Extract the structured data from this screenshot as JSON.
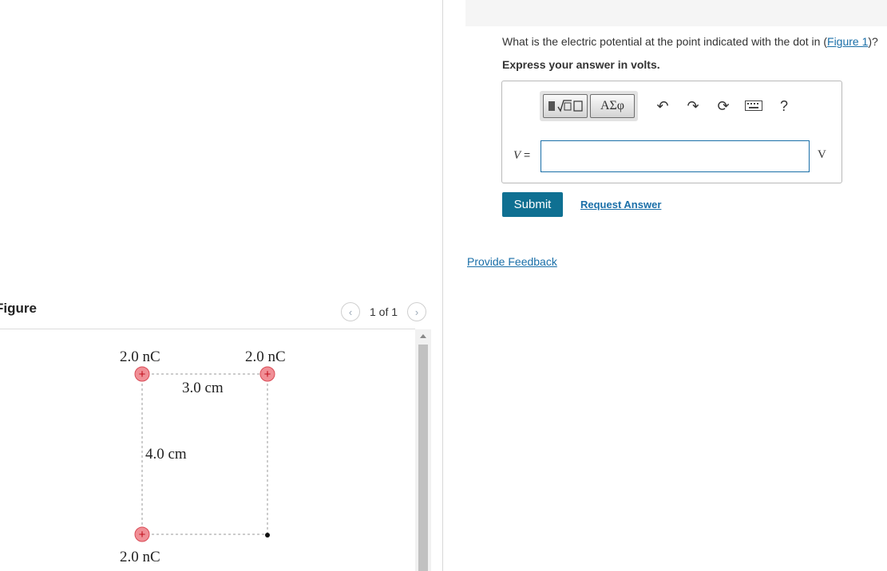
{
  "figure_panel": {
    "title": "Figure",
    "pager": {
      "prev_icon": "chevron-left-icon",
      "text": "1 of 1",
      "next_icon": "chevron-right-icon"
    },
    "diagram": {
      "charge_top_left": "2.0 nC",
      "charge_top_right": "2.0 nC",
      "charge_bottom_left": "2.0 nC",
      "horizontal_distance": "3.0 cm",
      "vertical_distance": "4.0 cm",
      "charge_symbol": "+",
      "charge_color": "#f08f96",
      "dot_color": "#111111"
    }
  },
  "question_panel": {
    "question_text": "What is the electric potential at the point indicated with the dot in (",
    "figure_link": "Figure 1",
    "question_end": ")?",
    "instruction": "Express your answer in volts.",
    "toolbar": {
      "templates_icon": "templates-icon",
      "symbols_label": "ΑΣφ",
      "undo_icon": "undo-icon",
      "redo_icon": "redo-icon",
      "reset_icon": "reset-icon",
      "keyboard_icon": "keyboard-icon",
      "help_label": "?"
    },
    "variable_label": "V",
    "equals": " =",
    "answer_value": "",
    "unit": "V",
    "submit_label": "Submit",
    "request_answer_label": "Request Answer",
    "feedback_label": "Provide Feedback",
    "accent_color": "#0f7092"
  }
}
